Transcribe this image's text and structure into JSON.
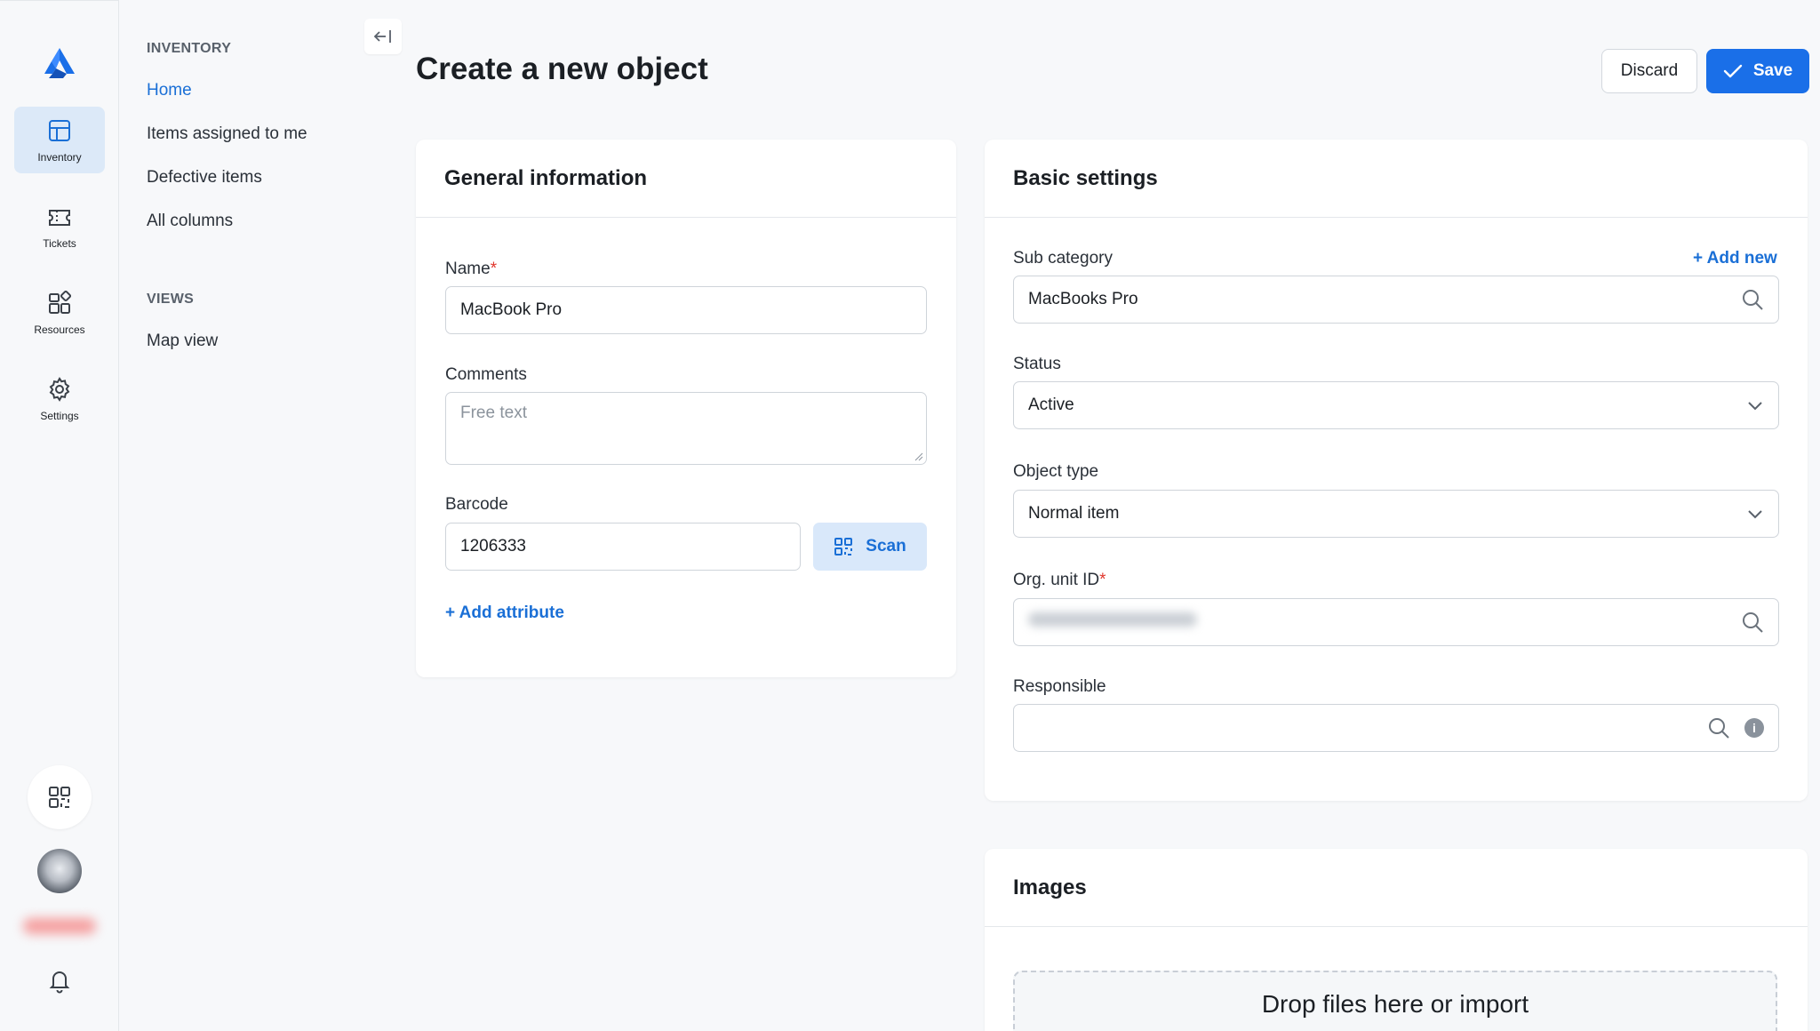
{
  "rail": {
    "items": [
      {
        "label": "Inventory",
        "icon": "grid-icon",
        "active": true
      },
      {
        "label": "Tickets",
        "icon": "ticket-icon",
        "active": false
      },
      {
        "label": "Resources",
        "icon": "resources-icon",
        "active": false
      },
      {
        "label": "Settings",
        "icon": "gear-icon",
        "active": false
      }
    ],
    "bottom_icons": [
      "qr-code-icon",
      "avatar",
      "bell-icon"
    ]
  },
  "subnav": {
    "section1": "INVENTORY",
    "links1": [
      "Home",
      "Items assigned to me",
      "Defective items",
      "All columns"
    ],
    "section2": "VIEWS",
    "links2": [
      "Map view"
    ]
  },
  "header": {
    "title": "Create a new object",
    "discard_label": "Discard",
    "save_label": "Save"
  },
  "general": {
    "title": "General information",
    "name_label": "Name",
    "name_value": "MacBook Pro",
    "comments_label": "Comments",
    "comments_placeholder": "Free text",
    "barcode_label": "Barcode",
    "barcode_value": "1206333",
    "scan_label": "Scan",
    "add_attribute": "+ Add attribute"
  },
  "basic": {
    "title": "Basic settings",
    "subcategory_label": "Sub category",
    "add_new": "+ Add new",
    "subcategory_value": "MacBooks Pro",
    "status_label": "Status",
    "status_value": "Active",
    "object_type_label": "Object type",
    "object_type_value": "Normal item",
    "org_unit_label": "Org. unit ID",
    "responsible_label": "Responsible"
  },
  "images": {
    "title": "Images",
    "dropzone_text": "Drop files here or import"
  },
  "required_mark": "*",
  "colors": {
    "accent": "#1a6fe8",
    "link": "#1a6fd6",
    "required": "#e0362c",
    "active_rail_bg": "#dce9f8"
  }
}
